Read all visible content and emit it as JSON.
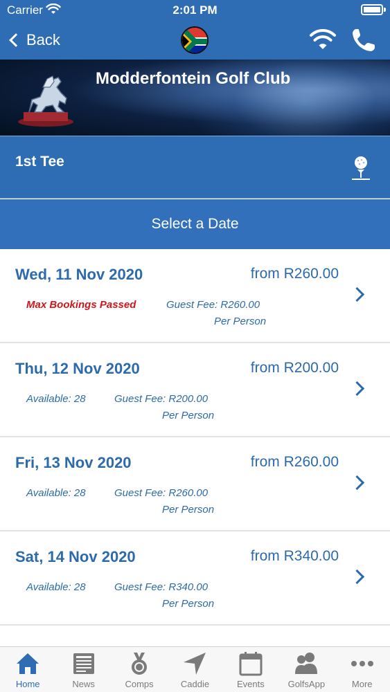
{
  "status_bar": {
    "carrier": "Carrier",
    "time": "2:01 PM"
  },
  "nav": {
    "back_label": "Back",
    "flag_icon": "south-africa-flag-icon",
    "wifi_icon": "wifi-icon",
    "phone_icon": "phone-icon"
  },
  "club": {
    "name": "Modderfontein Golf Club",
    "logo_icon": "horse-statue-logo"
  },
  "tee": {
    "label": "1st Tee",
    "icon": "golf-ball-on-tee-icon"
  },
  "date_header": "Select a Date",
  "dates": [
    {
      "date": "Wed, 11 Nov 2020",
      "price": "from R260.00",
      "availability": "Max Bookings Passed",
      "availability_warning": true,
      "fee": "Guest Fee: R260.00",
      "per": "Per Person"
    },
    {
      "date": "Thu, 12 Nov 2020",
      "price": "from R200.00",
      "availability": "Available: 28",
      "availability_warning": false,
      "fee": "Guest Fee: R200.00",
      "per": "Per Person"
    },
    {
      "date": "Fri, 13 Nov 2020",
      "price": "from R260.00",
      "availability": "Available: 28",
      "availability_warning": false,
      "fee": "Guest Fee: R260.00",
      "per": "Per Person"
    },
    {
      "date": "Sat, 14 Nov 2020",
      "price": "from R340.00",
      "availability": "Available: 28",
      "availability_warning": false,
      "fee": "Guest Fee: R340.00",
      "per": "Per Person"
    }
  ],
  "tabs": [
    {
      "label": "Home",
      "icon": "home-icon",
      "active": true
    },
    {
      "label": "News",
      "icon": "newspaper-icon",
      "active": false
    },
    {
      "label": "Comps",
      "icon": "medal-icon",
      "active": false
    },
    {
      "label": "Caddie",
      "icon": "navigation-arrow-icon",
      "active": false
    },
    {
      "label": "Events",
      "icon": "calendar-icon",
      "active": false
    },
    {
      "label": "GolfsApp",
      "icon": "people-icon",
      "active": false
    },
    {
      "label": "More",
      "icon": "more-dots-icon",
      "active": false
    }
  ],
  "colors": {
    "brand_blue": "#2e6db4",
    "text_blue": "#2c6aab",
    "warning_red": "#d0161b"
  }
}
